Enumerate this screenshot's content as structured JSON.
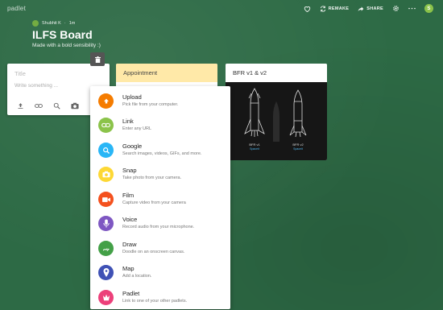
{
  "app": {
    "brand": "padlet"
  },
  "topbar": {
    "remake_label": "REMAKE",
    "share_label": "SHARE",
    "user_initial": "S"
  },
  "board": {
    "author": "Shubhit K",
    "time": "1m",
    "title": "ILFS Board",
    "subtitle": "Made with a bold sensibility :)"
  },
  "composer": {
    "title_placeholder": "Title",
    "body_placeholder": "Write something ..."
  },
  "columns": {
    "appointment": {
      "title": "Appointment"
    },
    "bfr": {
      "title": "BFR v1 & v2",
      "label_v1": "BFR v1",
      "label_v2": "BFR v2",
      "sub_v1": "Spaceit",
      "sub_v2": "Spaceit"
    }
  },
  "menu": {
    "items": [
      {
        "label": "Upload",
        "desc": "Pick file from your computer.",
        "color": "#f57c00",
        "icon": "upload-icon"
      },
      {
        "label": "Link",
        "desc": "Enter any URL",
        "color": "#8bc34a",
        "icon": "link-icon"
      },
      {
        "label": "Google",
        "desc": "Search images, videos, GIFs, and more.",
        "color": "#29b6f6",
        "icon": "search-icon"
      },
      {
        "label": "Snap",
        "desc": "Take photo from your camera.",
        "color": "#fdd835",
        "icon": "camera-icon"
      },
      {
        "label": "Film",
        "desc": "Capture video from your camera",
        "color": "#f4511e",
        "icon": "video-icon"
      },
      {
        "label": "Voice",
        "desc": "Record audio from your microphone.",
        "color": "#7e57c2",
        "icon": "mic-icon"
      },
      {
        "label": "Draw",
        "desc": "Doodle on an onscreen canvas.",
        "color": "#43a047",
        "icon": "draw-icon"
      },
      {
        "label": "Map",
        "desc": "Add a location.",
        "color": "#3f51b5",
        "icon": "map-pin-icon"
      },
      {
        "label": "Padlet",
        "desc": "Link to one of your other padlets.",
        "color": "#ec407a",
        "icon": "padlet-icon"
      }
    ]
  }
}
